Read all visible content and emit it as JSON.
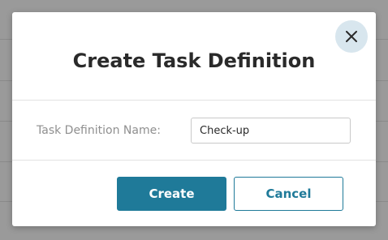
{
  "dialog": {
    "title": "Create Task Definition",
    "close_icon": "close-icon",
    "form": {
      "name_label": "Task Definition Name:",
      "name_value": "Check-up"
    },
    "buttons": {
      "create_label": "Create",
      "cancel_label": "Cancel"
    }
  },
  "colors": {
    "backdrop": "#9a9a9a",
    "primary": "#1f7a99",
    "close_button_bg": "#d8e6ee",
    "title_text": "#2a2a2a",
    "label_text": "#8f8f8f"
  }
}
